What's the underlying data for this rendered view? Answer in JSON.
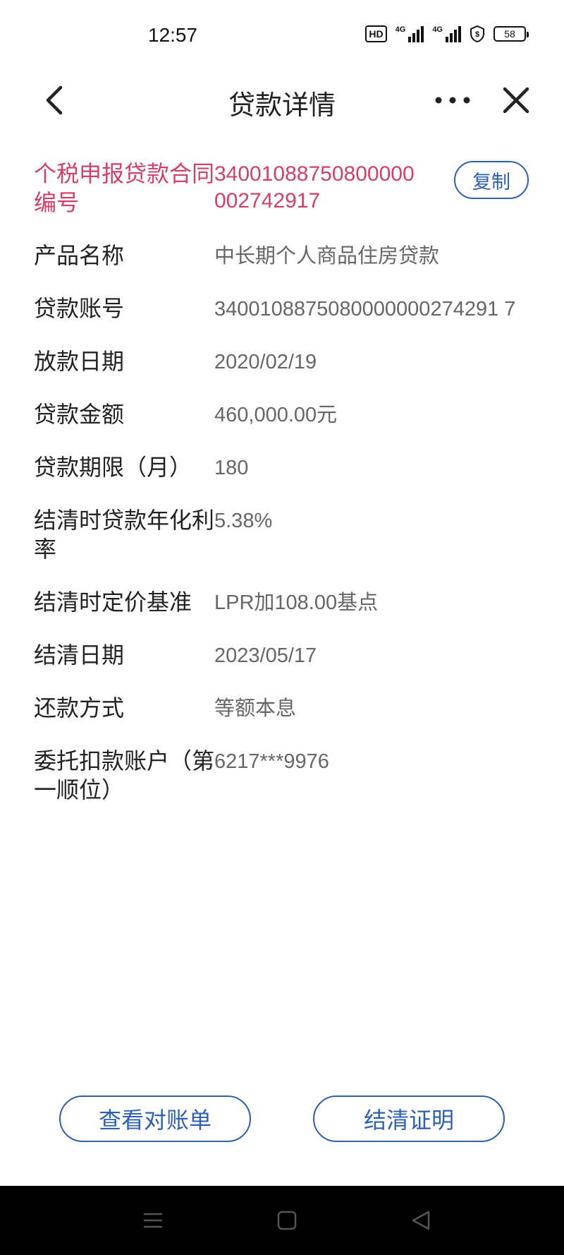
{
  "status_bar": {
    "time": "12:57",
    "hd_label": "HD",
    "network_1": "4G",
    "network_2": "4G",
    "battery": "58"
  },
  "nav": {
    "title": "贷款详情",
    "icons": [
      "back-chevron-icon",
      "more-dots-icon",
      "close-icon"
    ]
  },
  "detail": {
    "contract": {
      "label": "个税申报贷款合同编号",
      "value": "34001088750800000002742917",
      "copy_label": "复制"
    },
    "rows": [
      {
        "label": "产品名称",
        "value": "中长期个人商品住房贷款"
      },
      {
        "label": "贷款账号",
        "value": "3400108875080000000274291 7"
      },
      {
        "label": "放款日期",
        "value": "2020/02/19"
      },
      {
        "label": "贷款金额",
        "value": "460,000.00元"
      },
      {
        "label": "贷款期限（月）",
        "value": "180"
      },
      {
        "label": "结清时贷款年化利率",
        "value": "5.38%"
      },
      {
        "label": "结清时定价基准",
        "value": "LPR加108.00基点"
      },
      {
        "label": "结清日期",
        "value": "2023/05/17"
      },
      {
        "label": "还款方式",
        "value": "等额本息"
      },
      {
        "label": "委托扣款账户（第一顺位）",
        "value": "6217***9976"
      }
    ]
  },
  "actions": {
    "statement_label": "查看对账单",
    "settlement_label": "结清证明"
  },
  "colors": {
    "accent_blue": "#2e5fb0",
    "highlight_red": "#d0416a",
    "label_text": "#222222",
    "value_text": "#666666"
  }
}
